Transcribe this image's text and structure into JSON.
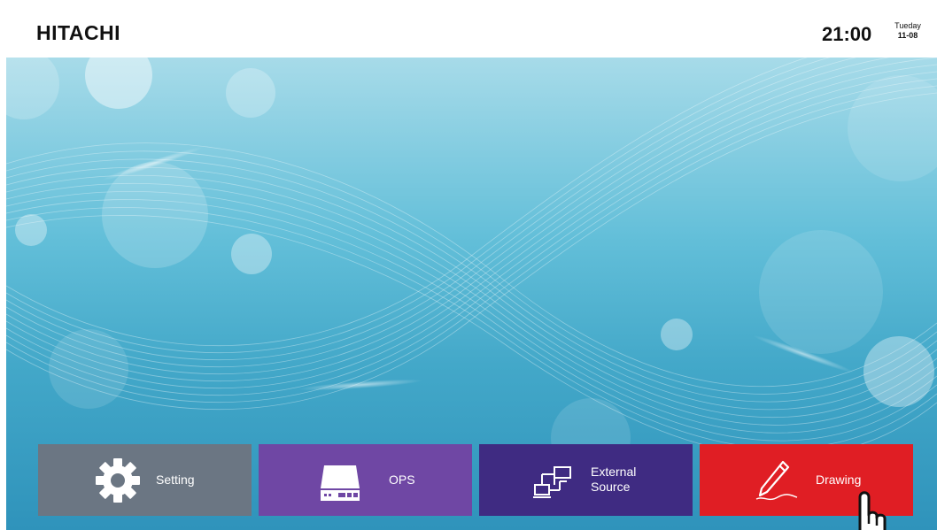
{
  "header": {
    "brand": "HITACHI",
    "time": "21:00",
    "weekday": "Tueday",
    "date": "11-08"
  },
  "tiles": [
    {
      "label": "Setting",
      "icon": "gear-icon",
      "color": "#6b7683"
    },
    {
      "label": "OPS",
      "icon": "ops-device-icon",
      "color": "#6f47a4"
    },
    {
      "label_line1": "External",
      "label_line2": "Source",
      "icon": "network-monitors-icon",
      "color": "#3f2b82"
    },
    {
      "label": "Drawing",
      "icon": "pen-icon",
      "color": "#e01e24"
    }
  ],
  "colors": {
    "wallpaper_top": "#a7dbe9",
    "wallpaper_bottom": "#2f93bb"
  },
  "cursor": {
    "icon": "hand-pointer-icon"
  }
}
